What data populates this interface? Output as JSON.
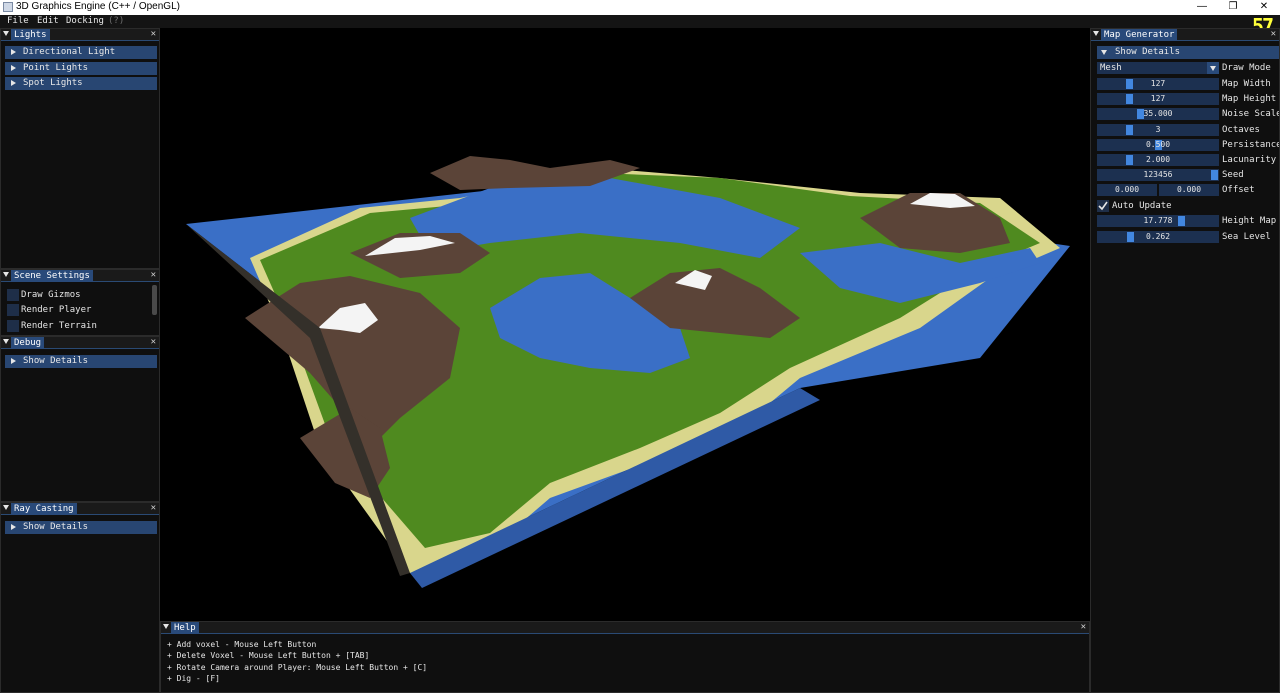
{
  "window": {
    "title": "3D Graphics Engine (C++ / OpenGL)",
    "minimize": "—",
    "restore": "❐",
    "close": "✕"
  },
  "menu": {
    "file": "File",
    "edit": "Edit",
    "docking": "Docking",
    "help": "(?)"
  },
  "fps": "57",
  "lights": {
    "tab": "Lights",
    "items": [
      "Directional Light",
      "Point Lights",
      "Spot Lights"
    ]
  },
  "scene_settings": {
    "tab": "Scene Settings",
    "items": [
      "Draw Gizmos",
      "Render Player",
      "Render Terrain"
    ]
  },
  "debug": {
    "tab": "Debug",
    "show_details": "Show Details"
  },
  "ray_casting": {
    "tab": "Ray Casting",
    "show_details": "Show Details"
  },
  "map_generator": {
    "tab": "Map Generator",
    "show_details": "Show Details",
    "draw_mode": {
      "value": "Mesh",
      "label": "Draw Mode"
    },
    "map_width": {
      "value": "127",
      "label": "Map Width",
      "fraction": 0.25
    },
    "map_height": {
      "value": "127",
      "label": "Map Height",
      "fraction": 0.25
    },
    "noise_scale": {
      "value": "35.000",
      "label": "Noise Scale",
      "fraction": 0.35
    },
    "octaves": {
      "value": "3",
      "label": "Octaves",
      "fraction": 0.25
    },
    "persistance": {
      "value": "0.500",
      "label": "Persistance",
      "fraction": 0.5
    },
    "lacunarity": {
      "value": "2.000",
      "label": "Lacunarity",
      "fraction": 0.25
    },
    "seed": {
      "value": "123456",
      "label": "Seed"
    },
    "offset": {
      "x": "0.000",
      "y": "0.000",
      "label": "Offset"
    },
    "auto_update": {
      "label": "Auto Update",
      "checked": true
    },
    "height_map": {
      "value": "17.778",
      "label": "Height Map M",
      "fraction": 0.7
    },
    "sea_level": {
      "value": "0.262",
      "label": "Sea Level",
      "fraction": 0.26
    }
  },
  "help": {
    "tab": "Help",
    "lines": [
      "+ Add voxel - Mouse Left Button",
      "+ Delete Voxel - Mouse Left Button + [TAB]",
      "+ Rotate Camera around Player: Mouse Left Button + [C]",
      "+ Dig - [F]"
    ]
  },
  "colors": {
    "water": "#3a6fc6",
    "sand": "#d9d68c",
    "grass": "#4f8a1f",
    "rock": "#5b4438",
    "snow": "#f4f4f4",
    "accent": "#4287e0",
    "tab": "#294a7a"
  }
}
